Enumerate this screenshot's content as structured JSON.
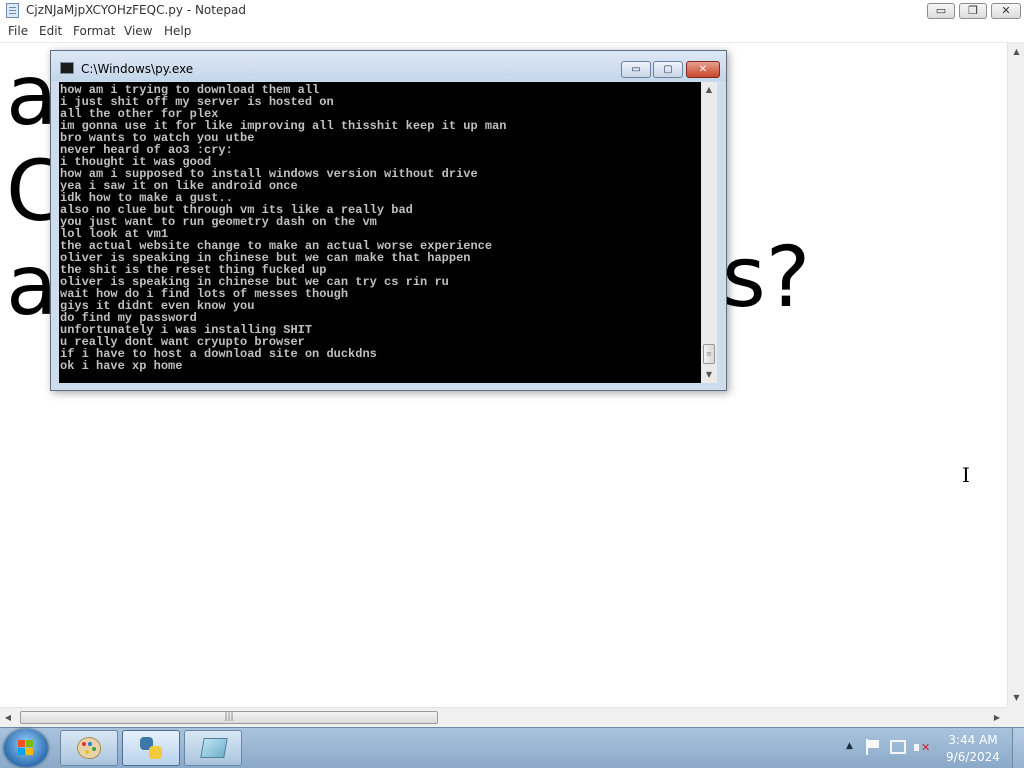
{
  "notepad": {
    "title": "CjzNJaMjpXCYOHzFEQC.py - Notepad",
    "controls": {
      "minimize": "▭",
      "maximize": "❐",
      "close": "✕"
    },
    "menu": [
      "File",
      "Edit",
      "Format",
      "View",
      "Help"
    ],
    "visible_text": {
      "line1": "a",
      "line2": "C",
      "line3": "a",
      "line3_right": "s?",
      "top_fragment": "▀"
    },
    "hscroll_grip": "|||"
  },
  "console": {
    "title": "C:\\Windows\\py.exe",
    "controls": {
      "minimize": "▭",
      "maximize": "▢",
      "close": "✕"
    },
    "lines": [
      "how am i trying to download them all",
      "i just shit off my server is hosted on",
      "all the other for plex",
      "im gonna use it for like improving all thisshit keep it up man",
      "bro wants to watch you utbe",
      "never heard of ao3 :cry:",
      "i thought it was good",
      "how am i supposed to install windows version without drive",
      "yea i saw it on like android once",
      "idk how to make a gust..",
      "also no clue but through vm its like a really bad",
      "you just want to run geometry dash on the vm",
      "lol look at vm1",
      "the actual website change to make an actual worse experience",
      "oliver is speaking in chinese but we can make that happen",
      "the shit is the reset thing fucked up",
      "oliver is speaking in chinese but we can try cs rin ru",
      "wait how do i find lots of messes though",
      "giys it didnt even know you",
      "do find my password",
      "unfortunately i was installing SHIT",
      "u really dont want cryupto browser",
      "if i have to host a download site on duckdns",
      "ok i have xp home"
    ],
    "scroll_grip": "≡"
  },
  "taskbar": {
    "pinned": [
      "paint-icon",
      "python-icon",
      "notepad-book-icon"
    ],
    "tray_arrow": "▲",
    "clock_time": "3:44 AM",
    "clock_date": "9/6/2024"
  },
  "colors": {
    "console_bg": "#000000",
    "console_text": "#c0c0c0",
    "taskbar": "#9ab6d4",
    "close_red": "#c8452d"
  }
}
